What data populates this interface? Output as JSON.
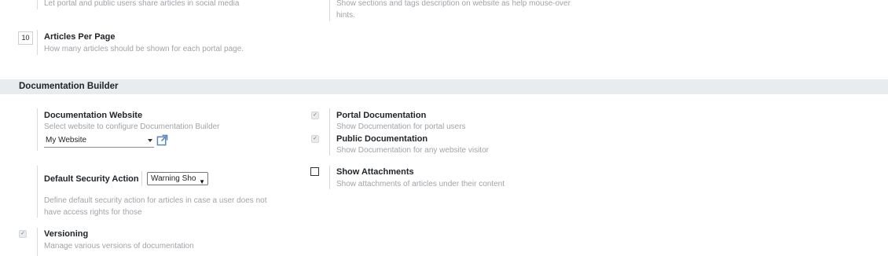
{
  "top": {
    "share_desc": "Let portal and public users share articles in social media",
    "hints_desc": "Show sections and tags description on website as help mouse-over hints.",
    "articles_per_page": {
      "value": "10",
      "title": "Articles Per Page",
      "desc": "How many articles should be shown for each portal page."
    }
  },
  "section": {
    "title": "Documentation Builder"
  },
  "builder": {
    "website": {
      "title": "Documentation Website",
      "desc": "Select website to configure Documentation Builder",
      "value": "My Website"
    },
    "security": {
      "title": "Default Security Action",
      "value": "Warning Sho",
      "desc": "Define default security action for articles in case a user does not have access rights for those"
    },
    "versioning": {
      "title": "Versioning",
      "desc": "Manage various versions of documentation",
      "checked": true
    },
    "portal_doc": {
      "title": "Portal Documentation",
      "desc": "Show Documentation for portal users",
      "checked": true
    },
    "public_doc": {
      "title": "Public Documentation",
      "desc": "Show Documentation for any website visitor",
      "checked": true
    },
    "attachments": {
      "title": "Show Attachments",
      "desc": "Show attachments of articles under their content",
      "checked": false
    }
  },
  "icons": {
    "check": "check-icon",
    "external_link": "external-link-icon",
    "dropdown": "chevron-down-icon"
  },
  "colors": {
    "accent": "#5b83c8",
    "section_bg": "#e9ecef"
  }
}
